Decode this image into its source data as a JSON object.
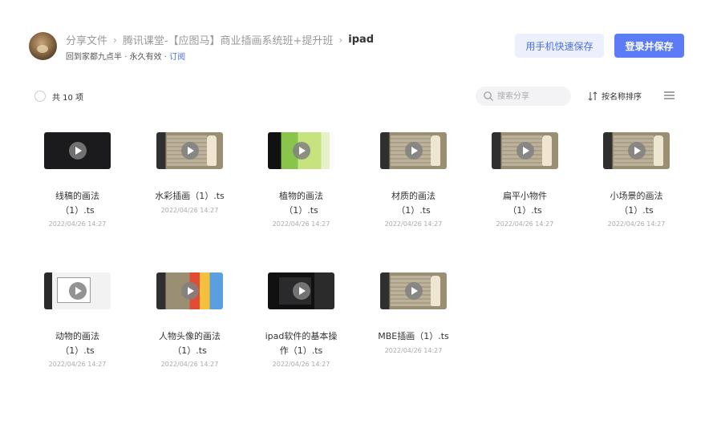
{
  "header": {
    "breadcrumb": [
      "分享文件",
      "腾讯课堂-【应图马】商业插画系统班+提升班",
      "ipad"
    ],
    "sharer": "回到家都九点半",
    "validity": "永久有效",
    "subscribe_label": "订阅",
    "mobile_save_label": "用手机快速保存",
    "login_save_label": "登录并保存",
    "colors": {
      "accent": "#5b7cf6",
      "accent_light": "#ecf0fd"
    }
  },
  "toolbar": {
    "count_label": "共 10 项",
    "search_placeholder": "搜索分享",
    "sort_label": "按名称排序"
  },
  "files": [
    {
      "name_line1": "线稿的画法",
      "name_line2": "（1）.ts",
      "date": "2022/04/26 14:27",
      "thumb": "dark"
    },
    {
      "name_line1": "水彩插画（1）.ts",
      "name_line2": "",
      "date": "2022/04/26 14:27",
      "thumb": "desk"
    },
    {
      "name_line1": "植物的画法",
      "name_line2": "（1）.ts",
      "date": "2022/04/26 14:27",
      "thumb": "green"
    },
    {
      "name_line1": "材质的画法",
      "name_line2": "（1）.ts",
      "date": "2022/04/26 14:27",
      "thumb": "desk"
    },
    {
      "name_line1": "扁平小物件",
      "name_line2": "（1）.ts",
      "date": "2022/04/26 14:27",
      "thumb": "desk"
    },
    {
      "name_line1": "小场景的画法",
      "name_line2": "（1）.ts",
      "date": "2022/04/26 14:27",
      "thumb": "desk"
    },
    {
      "name_line1": "动物的画法",
      "name_line2": "（1）.ts",
      "date": "2022/04/26 14:27",
      "thumb": "white"
    },
    {
      "name_line1": "人物头像的画法",
      "name_line2": "（1）.ts",
      "date": "2022/04/26 14:27",
      "thumb": "colorful"
    },
    {
      "name_line1": "ipad软件的基本操",
      "name_line2": "作（1）.ts",
      "date": "2022/04/26 14:27",
      "thumb": "dark2"
    },
    {
      "name_line1": "MBE插画（1）.ts",
      "name_line2": "",
      "date": "2022/04/26 14:27",
      "thumb": "desk"
    }
  ]
}
